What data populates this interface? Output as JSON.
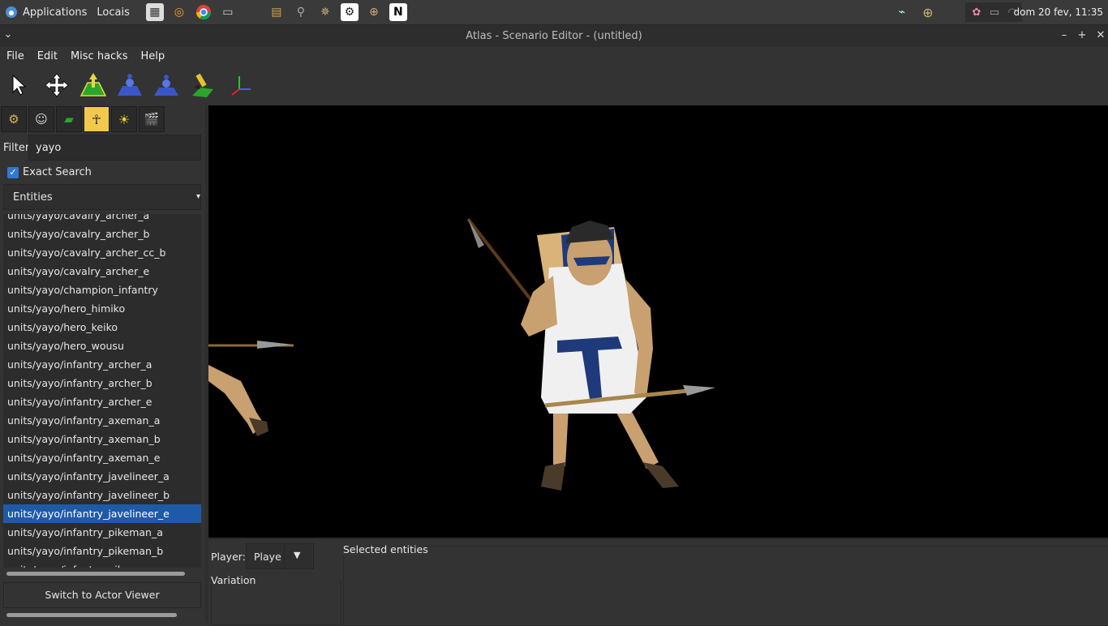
{
  "taskbar": {
    "applications_label": "Applications",
    "places_label": "Locais",
    "clock": "dom 20 fev, 11:35",
    "launchers": [
      "file-manager-icon",
      "blender-icon",
      "chrome-icon",
      "folder-icon",
      "archive-icon",
      "magnifier-icon",
      "compass-icon",
      "settings-gear-icon",
      "crosshair-icon",
      "notion-icon"
    ]
  },
  "window": {
    "title": "Atlas - Scenario Editor - (untitled)"
  },
  "menubar": {
    "items": [
      "File",
      "Edit",
      "Misc hacks",
      "Help"
    ]
  },
  "left_panel": {
    "filter_label": "Filter",
    "filter_value": "yayo",
    "exact_search_label": "Exact Search",
    "exact_search_checked": true,
    "category": "Entities",
    "list_items": [
      "units/yayo/cavalry_archer_a",
      "units/yayo/cavalry_archer_b",
      "units/yayo/cavalry_archer_cc_b",
      "units/yayo/cavalry_archer_e",
      "units/yayo/champion_infantry",
      "units/yayo/hero_himiko",
      "units/yayo/hero_keiko",
      "units/yayo/hero_wousu",
      "units/yayo/infantry_archer_a",
      "units/yayo/infantry_archer_b",
      "units/yayo/infantry_archer_e",
      "units/yayo/infantry_axeman_a",
      "units/yayo/infantry_axeman_b",
      "units/yayo/infantry_axeman_e",
      "units/yayo/infantry_javelineer_a",
      "units/yayo/infantry_javelineer_b",
      "units/yayo/infantry_javelineer_e",
      "units/yayo/infantry_pikeman_a",
      "units/yayo/infantry_pikeman_b",
      "units/yayo/infantry_pikeman_e"
    ],
    "selected_item": "units/yayo/infantry_javelineer_e",
    "switch_button": "Switch to Actor Viewer"
  },
  "bottom_panel": {
    "player_label": "Player:",
    "player_value": "Player",
    "variation_label": "Variation",
    "selected_entities_label": "Selected entities"
  },
  "colors": {
    "accent": "#1f5aa8",
    "active_tab": "#f2c94c",
    "viewport": "#000000"
  }
}
